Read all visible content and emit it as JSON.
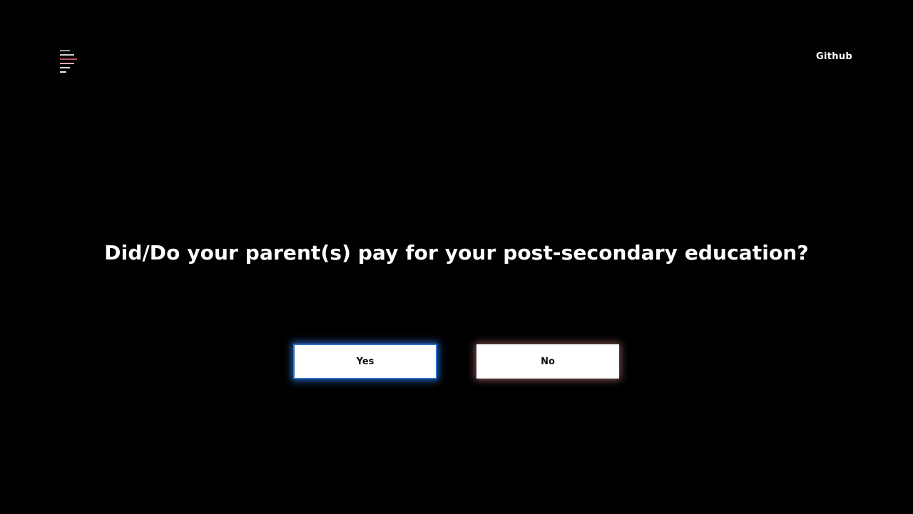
{
  "header": {
    "logo_bar_colors": [
      "#8fa892",
      "#c9d4c9",
      "#b3545a",
      "#e0a8aa",
      "#d9d9d9",
      "#e8e8e8"
    ],
    "nav_link": "Github"
  },
  "question": {
    "text": "Did/Do your parent(s) pay for your post-secondary education?"
  },
  "answers": {
    "yes_label": "Yes",
    "no_label": "No"
  },
  "colors": {
    "background": "#000000",
    "text": "#ffffff",
    "button_bg": "#ffffff",
    "focus_ring": "#2a6fc9"
  }
}
